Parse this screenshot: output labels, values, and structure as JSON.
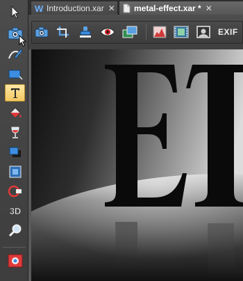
{
  "tabs": [
    {
      "label": "Introduction.xar",
      "icon": "w-document-icon",
      "close": "✕"
    },
    {
      "label": "metal-effect.xar *",
      "icon": "document-icon",
      "close": "✕"
    }
  ],
  "context_toolbar": {
    "exif_label": "EXIF"
  },
  "colors": {
    "accent_active_tool": "#f4c860",
    "toolbar_bg": "#454545",
    "canvas_bg": "#1b1b1b"
  }
}
